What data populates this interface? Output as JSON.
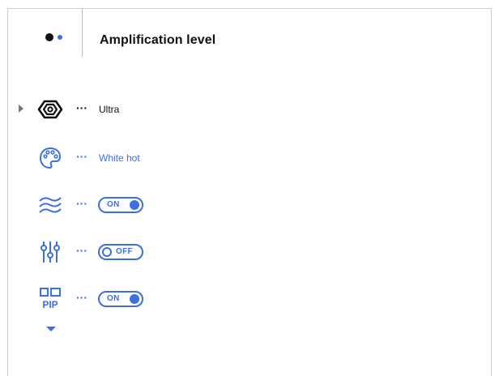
{
  "header": {
    "title": "Amplification level"
  },
  "rows": [
    {
      "ellipsis": "···",
      "value": "Ultra",
      "icon": "amplification-hexagon-icon"
    },
    {
      "ellipsis": "···",
      "value": "White hot",
      "icon": "palette-icon"
    },
    {
      "ellipsis": "···",
      "toggle": "ON",
      "icon": "heat-waves-icon"
    },
    {
      "ellipsis": "···",
      "toggle": "OFF",
      "icon": "sliders-icon"
    },
    {
      "ellipsis": "···",
      "toggle": "ON",
      "icon": "pip-icon",
      "icon_text": "PIP"
    }
  ],
  "colors": {
    "accent": "#3d6fe0",
    "text": "#111111",
    "divider": "#bdbdbd"
  }
}
